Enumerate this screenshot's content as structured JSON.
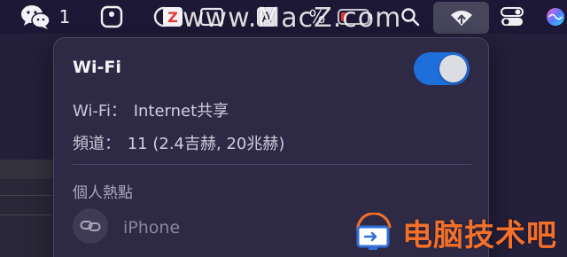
{
  "menubar": {
    "wechat_count": "1",
    "battery_percent": "%",
    "icons": [
      "wechat-icon",
      "square-app-icon",
      "circle-icon",
      "z-app-icon",
      "w-app-icon",
      "input-method-icon",
      "battery-icon",
      "search-icon",
      "wifi-hotspot-icon",
      "control-center-icon",
      "siri-icon"
    ]
  },
  "watermark": {
    "top_text": "www.MacZ.com",
    "bottom_text": "电脑技术吧"
  },
  "wifi_panel": {
    "title": "Wi-Fi",
    "toggle_on": true,
    "network_label": "Wi-Fi：",
    "network_value": "Internet共享",
    "channel_label": "頻道：",
    "channel_value": "11 (2.4吉赫, 20兆赫)",
    "section_title": "個人熱點",
    "hotspot_device": "iPhone"
  },
  "colors": {
    "toggle_accent": "#1f6fdb",
    "panel_bg": "#2e2945",
    "watermark_orange": "#f4702a"
  }
}
